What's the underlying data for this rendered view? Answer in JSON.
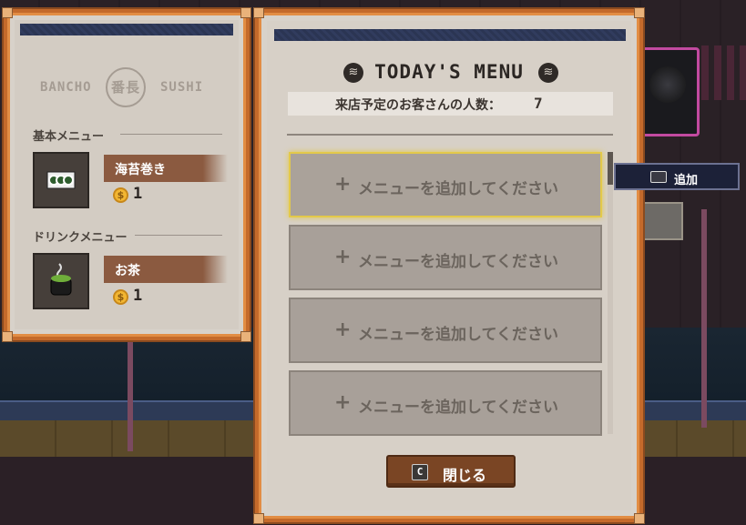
{
  "left_panel": {
    "logo": {
      "left": "BANCHO",
      "right": "SUSHI",
      "seal": "番長"
    },
    "basic_menu_title": "基本メニュー",
    "basic_item": {
      "name": "海苔巻き",
      "price": "1",
      "icon": "sushi-roll-icon"
    },
    "drink_menu_title": "ドリンクメニュー",
    "drink_item": {
      "name": "お茶",
      "price": "1",
      "icon": "tea-cup-icon"
    }
  },
  "main_panel": {
    "title": "TODAY'S MENU",
    "guest_label": "来店予定のお客さんの人数：",
    "guest_count": "7",
    "slots": [
      {
        "plus": "+",
        "label": "メニューを追加してください"
      },
      {
        "plus": "+",
        "label": "メニューを追加してください"
      },
      {
        "plus": "+",
        "label": "メニューを追加してください"
      },
      {
        "plus": "+",
        "label": "メニューを追加してください"
      }
    ],
    "close_button": {
      "key": "C",
      "label": "閉じる"
    }
  },
  "add_tooltip": {
    "label": "追加"
  },
  "colors": {
    "frame": "#c46a2b",
    "navy": "#2b3553",
    "selection": "#e3c94a",
    "brush": "#8b5a40"
  }
}
